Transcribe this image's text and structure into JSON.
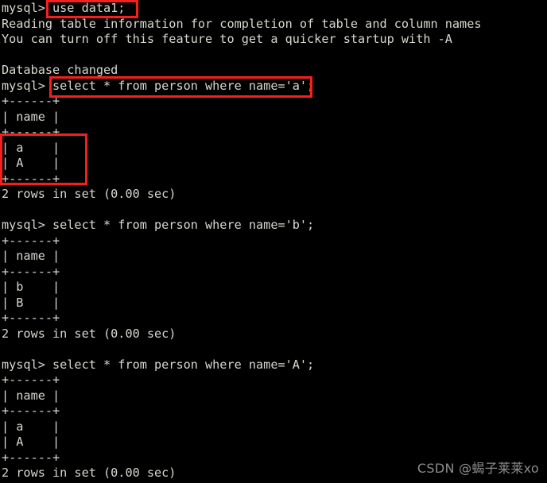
{
  "terminal": {
    "background_color": "#000000",
    "text_color": "#d8d8d0",
    "annotation_color": "#f51f1f",
    "lines": [
      "mysql> use data1;",
      "Reading table information for completion of table and column names",
      "You can turn off this feature to get a quicker startup with -A",
      "",
      "Database changed",
      "mysql> select * from person where name='a';",
      "+------+",
      "| name |",
      "+------+",
      "| a    |",
      "| A    |",
      "+------+",
      "2 rows in set (0.00 sec)",
      "",
      "mysql> select * from person where name='b';",
      "+------+",
      "| name |",
      "+------+",
      "| b    |",
      "| B    |",
      "+------+",
      "2 rows in set (0.00 sec)",
      "",
      "mysql> select * from person where name='A';",
      "+------+",
      "| name |",
      "+------+",
      "| a    |",
      "| A    |",
      "+------+",
      "2 rows in set (0.00 sec)"
    ]
  },
  "annotations": [
    {
      "name": "use-data1-command",
      "label": "use data1;"
    },
    {
      "name": "select-name-a-command",
      "label": "select * from person where name='a';"
    },
    {
      "name": "result-rows-a-A",
      "label": "| a    |  | A    |"
    }
  ],
  "watermark": {
    "text": "CSDN @蝎子莱莱xo"
  }
}
